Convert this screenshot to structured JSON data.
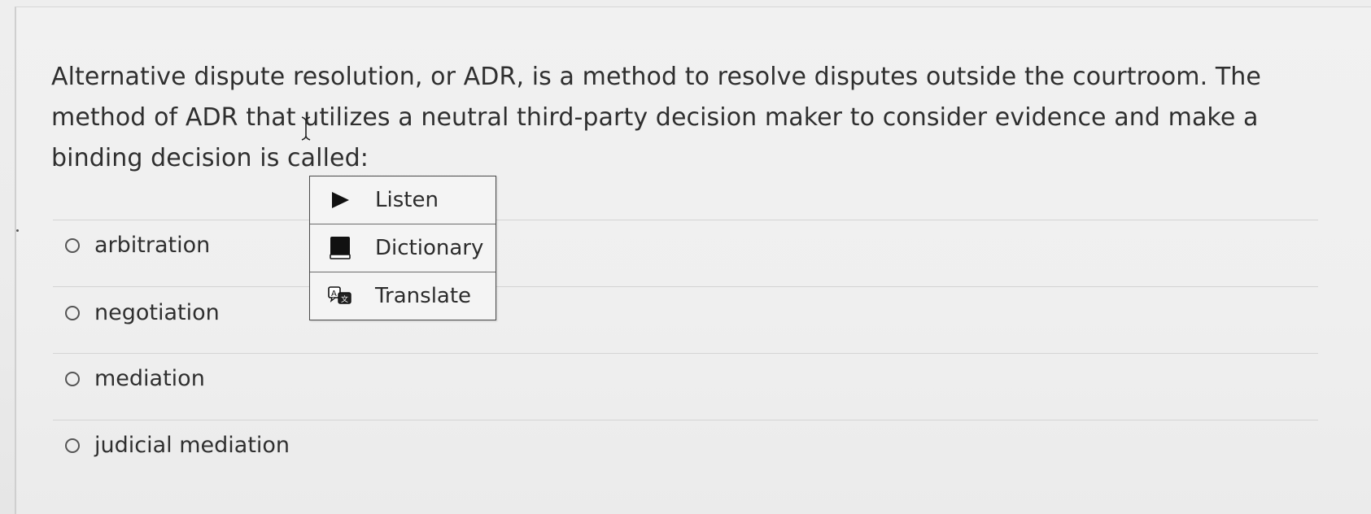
{
  "question": {
    "text": "Alternative dispute resolution, or ADR, is a method to resolve disputes outside the courtroom.  The method of ADR that utilizes a neutral third-party decision maker to consider evidence and make a binding decision is called:"
  },
  "options": [
    {
      "label": "arbitration"
    },
    {
      "label": "negotiation"
    },
    {
      "label": "mediation"
    },
    {
      "label": "judicial mediation"
    }
  ],
  "context_menu": {
    "items": [
      {
        "label": "Listen",
        "icon": "play-icon"
      },
      {
        "label": "Dictionary",
        "icon": "book-icon"
      },
      {
        "label": "Translate",
        "icon": "translate-icon"
      }
    ]
  }
}
